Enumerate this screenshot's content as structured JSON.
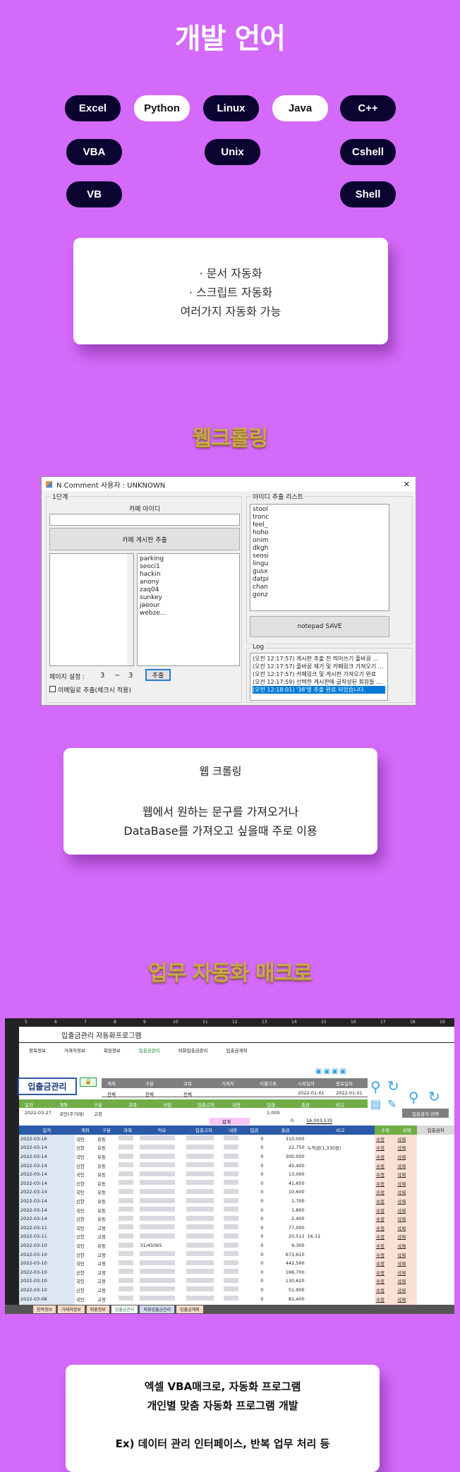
{
  "lang": {
    "title": "개발 언어",
    "pills": [
      "Excel",
      "Python",
      "Linux",
      "Java",
      "C++",
      "VBA",
      "Unix",
      "Cshell",
      "VB",
      "Shell"
    ],
    "card": [
      "· 문서 자동화",
      "· 스크립트 자동화",
      "여러가지 자동화 가능"
    ]
  },
  "crawl": {
    "title": "웹크롤링",
    "window": {
      "title": "N Comment 사용자 : UNKNOWN",
      "close": "✕",
      "step1": "1단계",
      "cafe_id_label": "카페 아이디",
      "cafe_id_value": "",
      "board_btn": "카페 게시판 추출",
      "boards": [
        "parking",
        "seoci1",
        "hackin",
        "anony",
        "zaq04",
        "sunkey",
        "jaeour",
        "webze..."
      ],
      "page_label": "페이지 설정 :",
      "page_from": "3",
      "page_sep": "~",
      "page_to": "3",
      "extract_btn": "추출",
      "email_check": "이메일로 추출(체크시 적용)",
      "idlist_label": "아이디 추출 리스트",
      "ids": [
        "stool",
        "tronc",
        "feel_",
        "hoho",
        "onim",
        "dkgh",
        "seosi",
        "lingu",
        "gusx",
        "datpi",
        "chan",
        "gonz"
      ],
      "save_btn": "notepad SAVE",
      "log_label": "Log",
      "log": [
        "(오전 12:17:57) 게시판 추출 전 띄어쓰기 줄바꿈 ...",
        "(오전 12:17:57) 줄바꿈 제거 및 카페링크 가져오기 ...",
        "(오전 12:17:57) 카페링크 및 게시판 가져오기 완료",
        "(오전 12:17:59) 선택한 게시판에 글작성된 회원들 ...",
        "(오전 12:18:01) '38'명 추출 완료 되었습니다."
      ]
    },
    "card": {
      "heading": "웹 크롤링",
      "lines": [
        "웹에서 원하는 문구를 가져오거나",
        "DataBase를 가져오고 싶을때 주로 이용"
      ]
    }
  },
  "macro": {
    "title": "업무 자동화 매크로",
    "sheet": {
      "cols": [
        "5",
        "6",
        "7",
        "8",
        "9",
        "10",
        "11",
        "12",
        "13",
        "14",
        "15",
        "16",
        "17",
        "18",
        "19"
      ],
      "app_title": "입출금관리 자동화프로그램",
      "nav": [
        "항목정보",
        "거래처정보",
        "회원정보",
        "입출금관리",
        "외화입출금관리",
        "입출금계획"
      ],
      "badge": "입출금관리",
      "filter_heads": [
        "계좌",
        "구분",
        "과목",
        "거래처",
        "이월기록",
        "시작일자",
        "종료일자"
      ],
      "filter_vals": [
        "전체",
        "전체",
        "전체",
        "",
        "",
        "2022-01-01",
        "2022-01-01"
      ],
      "input_heads": [
        "일자",
        "계좌",
        "구분",
        "과목",
        "사업",
        "입출고처",
        "내용",
        "입금",
        "출금",
        "비고"
      ],
      "input_vals": [
        "2022-03-27",
        "국민(주거래)",
        "고정",
        "",
        "",
        "",
        "",
        "1,000",
        "",
        ""
      ],
      "sum_label": "합계",
      "sum_in": "0",
      "sum_out": "16,003,535",
      "select_btn": "입출금처 선택",
      "headers": [
        "일자",
        "계좌",
        "구분",
        "과목",
        "적요",
        "입출고처",
        "내용",
        "입금",
        "출금",
        "비고",
        "수정",
        "삭제",
        "입출금처"
      ],
      "rows": [
        [
          "2022-03-16",
          "국민",
          "유동",
          "",
          "",
          "",
          "",
          "0",
          "310,000",
          "",
          "수정",
          "삭제",
          ""
        ],
        [
          "2022-03-14",
          "신한",
          "유동",
          "",
          "",
          "",
          "",
          "0",
          "22,750",
          "누적금(1,330원)",
          "수정",
          "삭제",
          ""
        ],
        [
          "2022-03-14",
          "국민",
          "유동",
          "",
          "",
          "",
          "",
          "0",
          "300,000",
          "",
          "수정",
          "삭제",
          ""
        ],
        [
          "2022-03-14",
          "신한",
          "유동",
          "",
          "",
          "",
          "",
          "0",
          "45,400",
          "",
          "수정",
          "삭제",
          ""
        ],
        [
          "2022-03-14",
          "국민",
          "유동",
          "",
          "",
          "",
          "",
          "0",
          "13,000",
          "",
          "수정",
          "삭제",
          ""
        ],
        [
          "2022-03-14",
          "신한",
          "유동",
          "",
          "",
          "",
          "",
          "0",
          "41,650",
          "",
          "수정",
          "삭제",
          ""
        ],
        [
          "2022-03-14",
          "국민",
          "유동",
          "",
          "",
          "",
          "",
          "0",
          "10,600",
          "",
          "수정",
          "삭제",
          ""
        ],
        [
          "2022-03-14",
          "신한",
          "유동",
          "",
          "",
          "",
          "",
          "0",
          "1,700",
          "",
          "수정",
          "삭제",
          ""
        ],
        [
          "2022-03-14",
          "국민",
          "유동",
          "",
          "",
          "",
          "",
          "0",
          "1,800",
          "",
          "수정",
          "삭제",
          ""
        ],
        [
          "2022-03-14",
          "신한",
          "유동",
          "",
          "",
          "",
          "",
          "0",
          "2,400",
          "",
          "수정",
          "삭제",
          ""
        ],
        [
          "2022-03-11",
          "국민",
          "고정",
          "",
          "",
          "",
          "",
          "0",
          "77,000",
          "",
          "수정",
          "삭제",
          ""
        ],
        [
          "2022-03-11",
          "신한",
          "고정",
          "",
          "",
          "",
          "",
          "0",
          "20,512",
          "16.11",
          "수정",
          "삭제",
          ""
        ],
        [
          "2022-03-10",
          "국민",
          "유동",
          "",
          "31/45065",
          "",
          "",
          "0",
          "9,300",
          "",
          "수정",
          "삭제",
          ""
        ],
        [
          "2022-03-10",
          "신한",
          "고정",
          "",
          "",
          "",
          "",
          "0",
          "673,610",
          "",
          "수정",
          "삭제",
          ""
        ],
        [
          "2022-03-10",
          "국민",
          "고정",
          "",
          "",
          "",
          "",
          "0",
          "442,560",
          "",
          "수정",
          "삭제",
          ""
        ],
        [
          "2022-03-10",
          "신한",
          "고정",
          "",
          "",
          "",
          "",
          "0",
          "166,700",
          "",
          "수정",
          "삭제",
          ""
        ],
        [
          "2022-03-10",
          "국민",
          "고정",
          "",
          "",
          "",
          "",
          "0",
          "130,620",
          "",
          "수정",
          "삭제",
          ""
        ],
        [
          "2022-03-10",
          "신한",
          "고정",
          "",
          "",
          "",
          "",
          "0",
          "51,900",
          "",
          "수정",
          "삭제",
          ""
        ],
        [
          "2022-03-08",
          "국민",
          "고정",
          "",
          "",
          "",
          "",
          "0",
          "81,400",
          "",
          "수정",
          "삭제",
          ""
        ],
        [
          "2022-03-07",
          "신한",
          "고정",
          "",
          "",
          "",
          "",
          "0",
          "220,000",
          "",
          "수정",
          "삭제",
          ""
        ]
      ],
      "tabs": [
        "항목정보",
        "거래처정보",
        "회원정보",
        "입출금관리",
        "외화입출금관리",
        "입출금계획"
      ]
    },
    "card": [
      "엑셀 VBA매크로, 자동화 프로그램",
      "개인별 맞춤 자동화 프로그램 개발",
      "",
      "Ex) 데이터 관리 인터페이스, 반복 업무 처리 등"
    ]
  },
  "colors": {
    "bg": "#d46af9",
    "pill_dark": "#0b0330",
    "excel_green": "#70ad47",
    "excel_blue": "#2a5aa8"
  }
}
